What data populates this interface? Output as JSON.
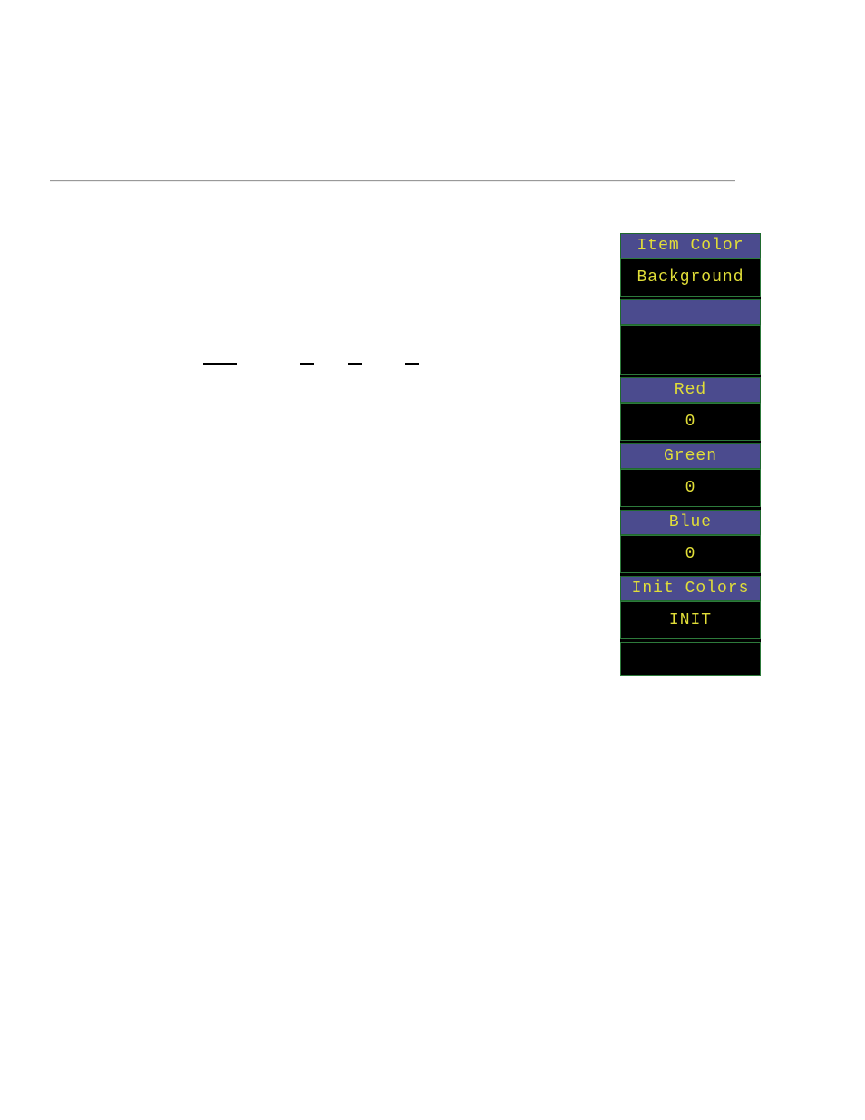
{
  "panel": {
    "title": "Item Color",
    "item_value": "Background",
    "red_label": "Red",
    "red_value": "0",
    "green_label": "Green",
    "green_value": "0",
    "blue_label": "Blue",
    "blue_value": "0",
    "init_label": "Init Colors",
    "init_action": "INIT"
  }
}
